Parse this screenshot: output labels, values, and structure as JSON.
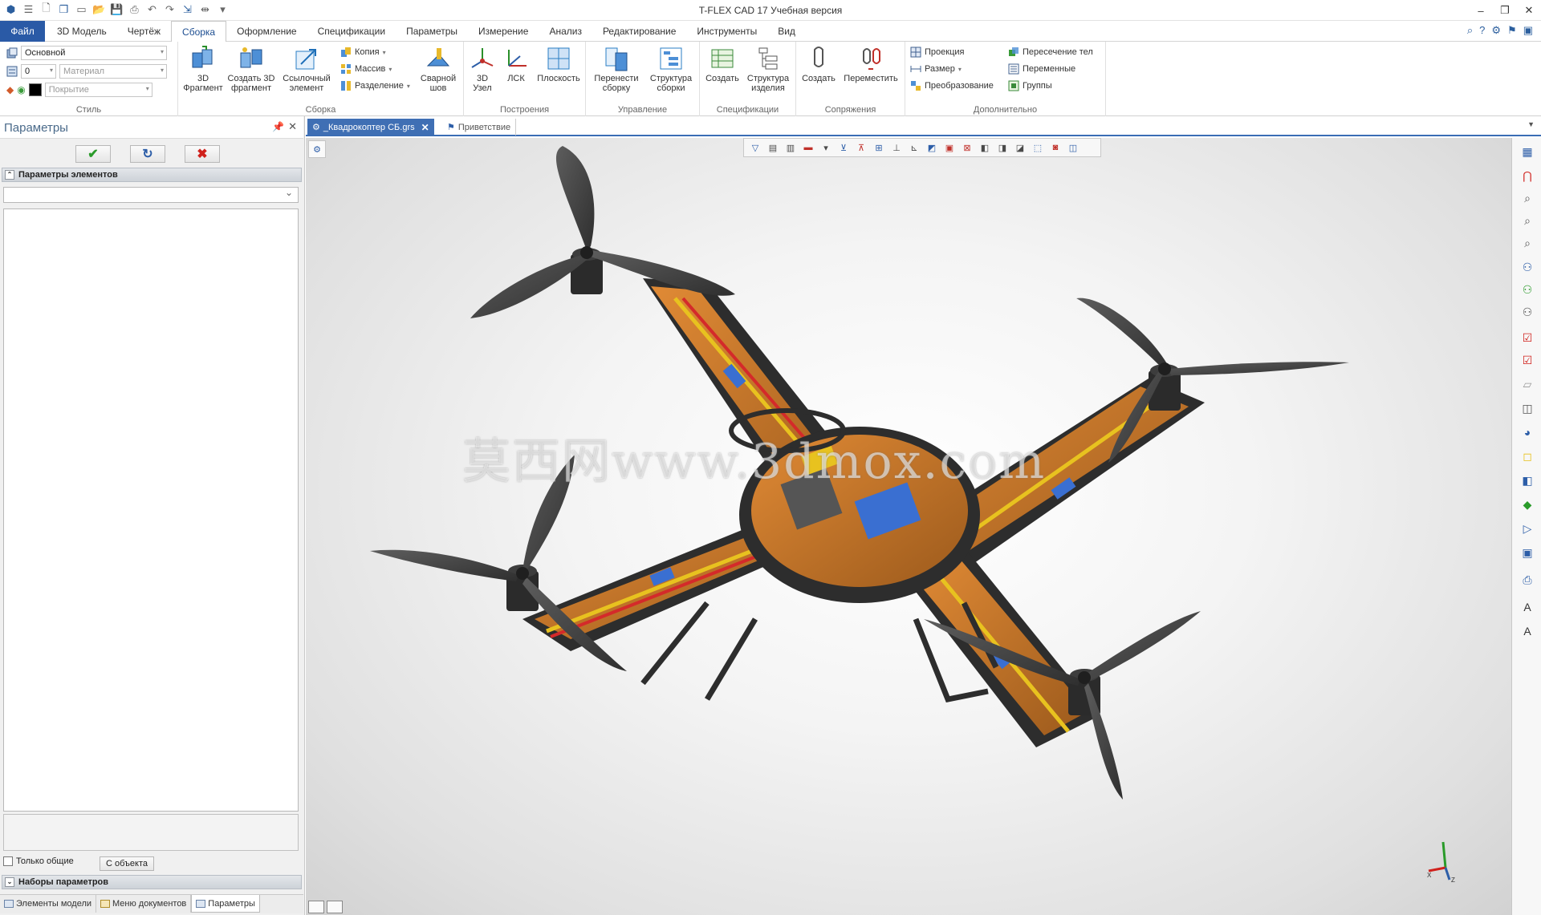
{
  "window": {
    "title": "T-FLEX CAD 17 Учебная версия"
  },
  "menu": {
    "file_tab": "Файл",
    "tabs": [
      "3D Модель",
      "Чертёж",
      "Сборка",
      "Оформление",
      "Спецификации",
      "Параметры",
      "Измерение",
      "Анализ",
      "Редактирование",
      "Инструменты",
      "Вид"
    ],
    "active_tab": "Сборка"
  },
  "ribbon": {
    "style": {
      "layer_value": "Основной",
      "level_value": "0",
      "material_placeholder": "Материал",
      "coating_placeholder": "Покрытие",
      "color_value": "#000000",
      "label": "Стиль"
    },
    "assembly": {
      "label": "Сборка",
      "btn_3d_fragment": "3D\nФрагмент",
      "btn_create_fragment": "Создать 3D\nфрагмент",
      "btn_reference_element": "Ссылочный\nэлемент",
      "copy": "Копия",
      "array": "Массив",
      "split": "Разделение",
      "weld": "Сварной\nшов"
    },
    "construction": {
      "label": "Построения",
      "node": "3D\nУзел",
      "lcs": "ЛСК",
      "plane": "Плоскость"
    },
    "management": {
      "label": "Управление",
      "transfer": "Перенести\nсборку",
      "structure": "Структура\nсборки"
    },
    "specifications": {
      "label": "Спецификации",
      "create": "Создать",
      "product_structure": "Структура\nизделия"
    },
    "mates": {
      "label": "Сопряжения",
      "create": "Создать",
      "move": "Переместить"
    },
    "additional": {
      "label": "Дополнительно",
      "projection": "Проекция",
      "dimension": "Размер",
      "transformation": "Преобразование",
      "body_intersection": "Пересечение тел",
      "variables": "Переменные",
      "groups": "Группы"
    }
  },
  "panel": {
    "title": "Параметры",
    "section_element_params": "Параметры элементов",
    "only_common_label": "Только общие",
    "from_object_button": "С объекта",
    "section_param_sets": "Наборы параметров",
    "bottom_tabs": [
      "Элементы модели",
      "Меню документов",
      "Параметры"
    ],
    "active_bottom_tab": "Параметры"
  },
  "documents": {
    "active_tab": "_Квадрокоптер СБ.grs",
    "second_tab": "Приветствие"
  },
  "viewport": {
    "watermark": "莫西网www.3dmox.com",
    "model_colors": {
      "frame": "#c7772b",
      "propeller": "#4a4a4a",
      "background": "#e8e8e8"
    },
    "axes": {
      "x": "X",
      "z": "Z"
    }
  }
}
